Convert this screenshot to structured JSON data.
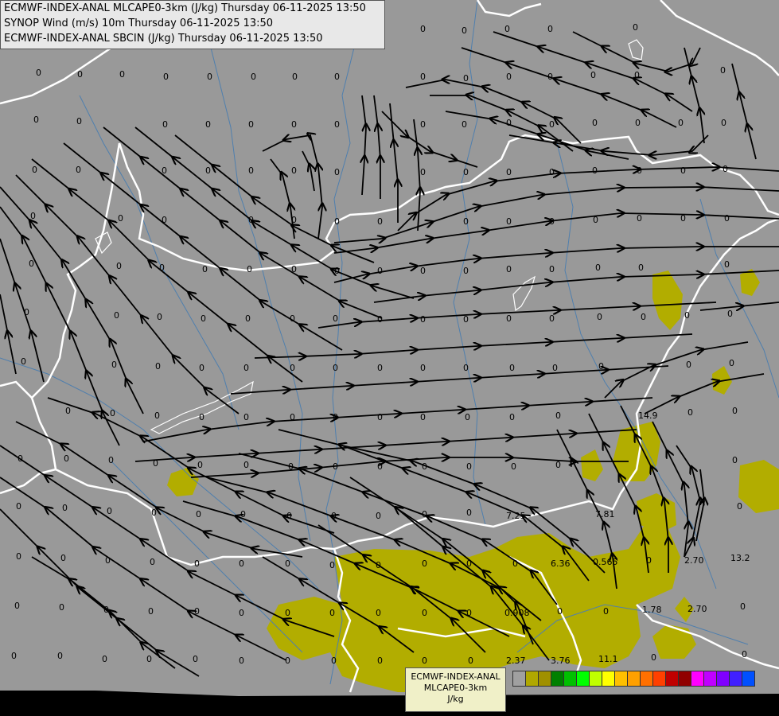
{
  "header": {
    "line1": "ECMWF-INDEX-ANAL MLCAPE0-3km (J/kg) Thursday 06-11-2025 13:50",
    "line2": "SYNOP Wind (m/s) 10m Thursday 06-11-2025 13:50",
    "line3": "ECMWF-INDEX-ANAL SBCIN (J/kg) Thursday 06-11-2025 13:50"
  },
  "legend": {
    "line1": "ECMWF-INDEX-ANAL",
    "line2": "MLCAPE0-3km",
    "unit": "J/kg",
    "colors": [
      "#a0a0a0",
      "#b0a800",
      "#a09000",
      "#008000",
      "#00c000",
      "#00ff00",
      "#c0ff00",
      "#ffff00",
      "#ffc000",
      "#ffa000",
      "#ff7000",
      "#ff4000",
      "#c00000",
      "#900000",
      "#ff00ff",
      "#c000ff",
      "#8000ff",
      "#4020ff",
      "#0050ff",
      "#00a0ff",
      "#00ffff",
      "#a0ffff",
      "#ffffff"
    ],
    "ticks": [
      "0",
      "12",
      "30",
      "50",
      "70",
      "90",
      "120",
      "160",
      "250",
      "400"
    ]
  },
  "colors": {
    "background": "#999999",
    "cape_fill": "#b2ad00",
    "border": "#ffffff",
    "river": "#4f7fae",
    "streamline": "#000000"
  },
  "cin_values": [
    "0",
    "0",
    "0",
    "0",
    "0",
    "0",
    "0",
    "0",
    "0",
    "0",
    "0",
    "0",
    "0",
    "0",
    "0",
    "0",
    "14.9",
    "13.2",
    "7.81",
    "7.25",
    "6.36",
    "0.565",
    "2.70",
    "2.70",
    "1.78",
    "0.908",
    "2.37",
    "3.76",
    "11.1"
  ]
}
